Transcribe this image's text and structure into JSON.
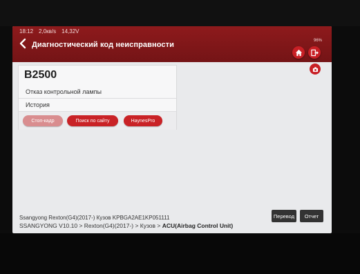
{
  "status": {
    "time": "18:12",
    "speed": "2,0кв/s",
    "voltage": "14,32V",
    "battery": "96%"
  },
  "header": {
    "title": "Диагностический код неисправности"
  },
  "dtc": {
    "code": "B2500",
    "description": "Отказ контрольной лампы",
    "history": "История"
  },
  "actions": {
    "freeze_frame": "Стоп-кадр",
    "site_search": "Поиск по сайту",
    "haynes": "HaynesPro"
  },
  "footer": {
    "vehicle_info": "Ssangyong  Rexton(G4)(2017-) Кузов  KPBGA2AE1KP051111",
    "path_prefix": "SSANGYONG V10.10 > Rexton(G4)(2017-) > Кузов > ",
    "path_module": "ACU(Airbag Control Unit)",
    "translate_label": "Перевод",
    "report_label": "Отчет"
  },
  "colors": {
    "header": "#7e1719",
    "accent": "#c92226",
    "disabled": "#d98d8f"
  }
}
